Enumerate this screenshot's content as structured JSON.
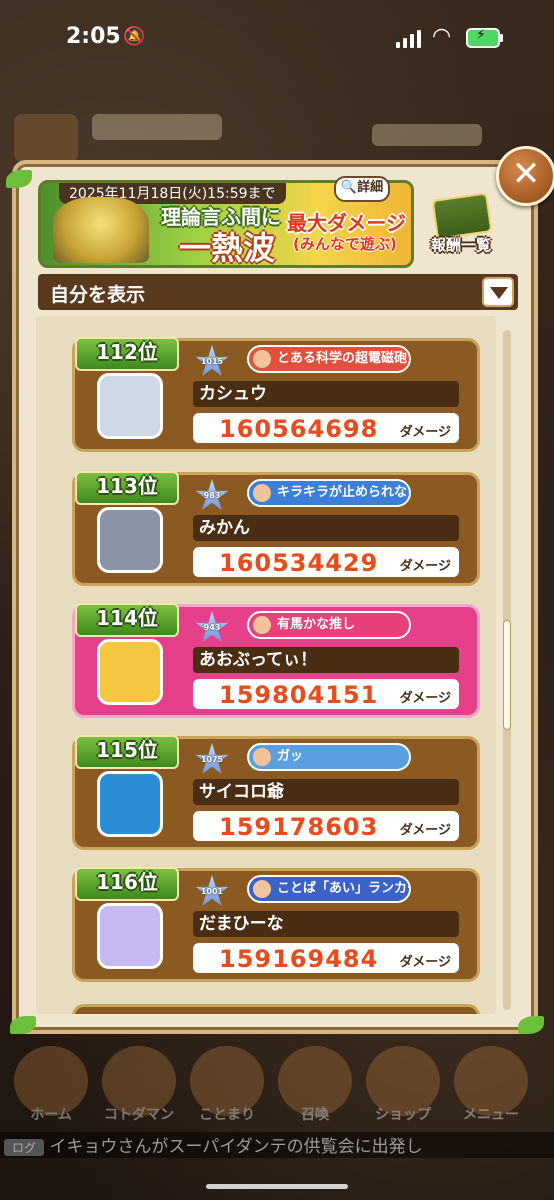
{
  "status": {
    "time": "2:05"
  },
  "event": {
    "date": "2025年11月18日(火)15:59まで",
    "title_small": "理論言ふ間に",
    "title_big": "一熱波",
    "mode_main": "最大ダメージ",
    "mode_sub": "(みんなで遊ぶ)",
    "detail_label": "詳細",
    "reward_label": "報酬一覧"
  },
  "filter": {
    "label": "自分を表示"
  },
  "damage_unit": "ダメージ",
  "rankings": [
    {
      "rank": "112位",
      "name": "カシュウ",
      "damage": "160564698",
      "level": "1015",
      "title": "とある科学の超電磁砲",
      "is_self": false,
      "title_color": "#e0503a",
      "avatar_color": "#cfd8e6"
    },
    {
      "rank": "113位",
      "name": "みかん",
      "damage": "160534429",
      "level": "983",
      "title": "キラキラが止められないよ☆",
      "is_self": false,
      "title_color": "#3b7fd9",
      "avatar_color": "#8a94a6"
    },
    {
      "rank": "114位",
      "name": "あおぶってぃ！",
      "damage": "159804151",
      "level": "943",
      "title": "有馬かな推し",
      "is_self": true,
      "title_color": "#e8407a",
      "avatar_color": "#f5c640"
    },
    {
      "rank": "115位",
      "name": "サイコロ爺",
      "damage": "159178603",
      "level": "1075",
      "title": "ガッ",
      "is_self": false,
      "title_color": "#5aa0e0",
      "avatar_color": "#2a8fd8"
    },
    {
      "rank": "116位",
      "name": "だまひーな",
      "damage": "159169484",
      "level": "1001",
      "title": "ことば「あい」ランカー",
      "is_self": false,
      "title_color": "#3b62c9",
      "avatar_color": "#c6b8f0"
    }
  ],
  "nav": [
    "ホーム",
    "コトダマン",
    "ことまり",
    "召喚",
    "ショップ",
    "メニュー"
  ],
  "ticker": {
    "tag": "ログ",
    "text": "イキョウさんがスーパイダンテの供覧会に出発し"
  }
}
